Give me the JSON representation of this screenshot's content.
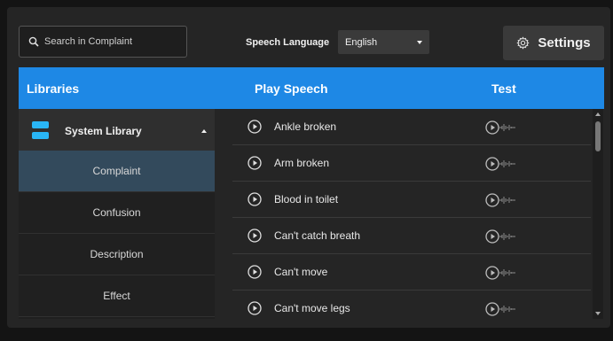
{
  "search": {
    "placeholder": "Search in Complaint",
    "icon": "search-icon"
  },
  "language": {
    "label": "Speech Language",
    "selected": "English"
  },
  "settings": {
    "label": "Settings",
    "icon": "gear-icon"
  },
  "header": {
    "libraries": "Libraries",
    "play_speech": "Play Speech",
    "test": "Test"
  },
  "sidebar": {
    "library": {
      "name": "System Library",
      "icon": "library-icon",
      "expanded": true
    },
    "items": [
      {
        "label": "Complaint",
        "active": true
      },
      {
        "label": "Confusion",
        "active": false
      },
      {
        "label": "Description",
        "active": false
      },
      {
        "label": "Effect",
        "active": false
      }
    ]
  },
  "speech_list": [
    {
      "name": "Ankle broken"
    },
    {
      "name": "Arm broken"
    },
    {
      "name": "Blood in toilet"
    },
    {
      "name": "Can't catch breath"
    },
    {
      "name": "Can't move"
    },
    {
      "name": "Can't move legs"
    }
  ],
  "colors": {
    "accent": "#1e88e5",
    "panel": "#252525",
    "active_item": "#334a5c",
    "library_icon": "#29b6f6"
  }
}
